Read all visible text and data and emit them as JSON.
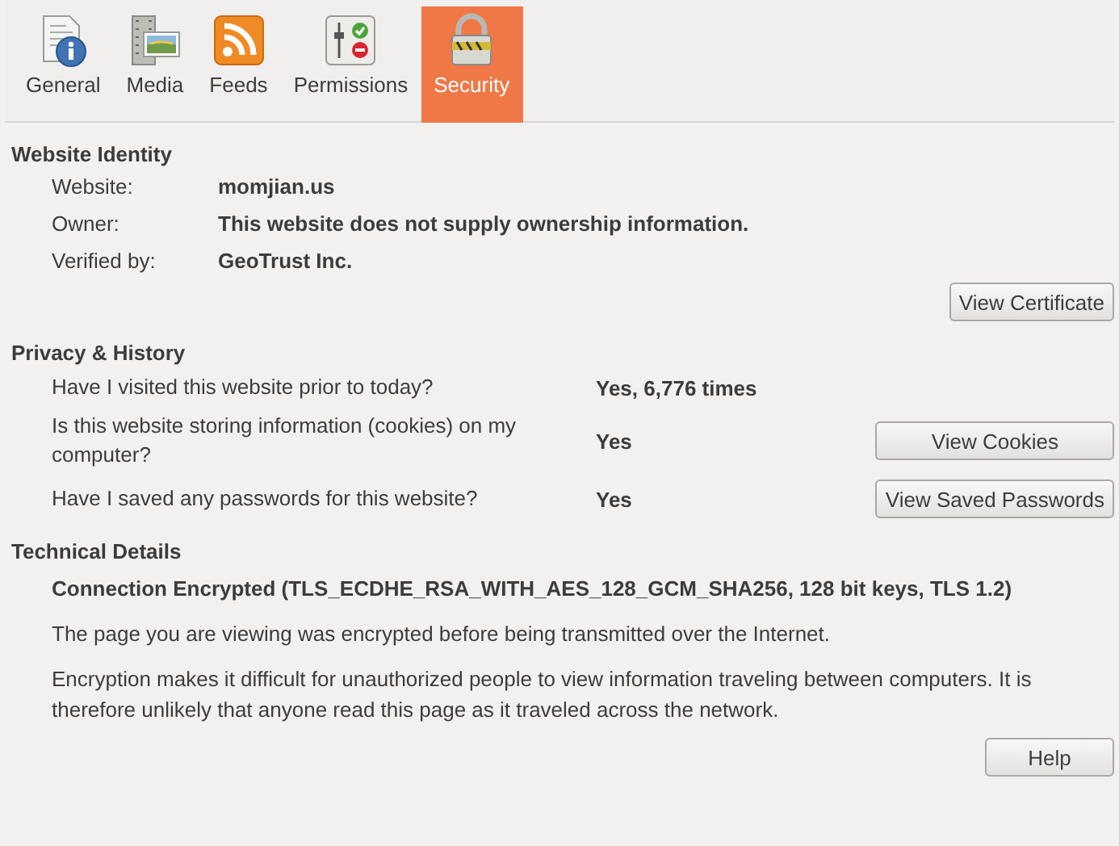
{
  "tabs": [
    {
      "label": "General",
      "kind": "general",
      "selected": false
    },
    {
      "label": "Media",
      "kind": "media",
      "selected": false
    },
    {
      "label": "Feeds",
      "kind": "feeds",
      "selected": false
    },
    {
      "label": "Permissions",
      "kind": "permissions",
      "selected": false
    },
    {
      "label": "Security",
      "kind": "security",
      "selected": true
    }
  ],
  "website_identity": {
    "title": "Website Identity",
    "rows": [
      {
        "label": "Website:",
        "value": "momjian.us"
      },
      {
        "label": "Owner:",
        "value": "This website does not supply ownership information."
      },
      {
        "label": "Verified by:",
        "value": "GeoTrust Inc."
      }
    ],
    "button": "View Certificate"
  },
  "privacy_history": {
    "title": "Privacy & History",
    "rows": [
      {
        "question": "Have I visited this website prior to today?",
        "answer": "Yes, 6,776 times"
      },
      {
        "question": "Is this website storing information (cookies) on my computer?",
        "answer": "Yes",
        "button": "View Cookies"
      },
      {
        "question": "Have I saved any passwords for this website?",
        "answer": "Yes",
        "button": "View Saved Passwords"
      }
    ]
  },
  "technical_details": {
    "title": "Technical Details",
    "heading": "Connection Encrypted (TLS_ECDHE_RSA_WITH_AES_128_GCM_SHA256, 128 bit keys, TLS 1.2)",
    "paragraphs": [
      "The page you are viewing was encrypted before being transmitted over the Internet.",
      "Encryption makes it difficult for unauthorized people to view information traveling between computers. It is therefore unlikely that anyone read this page as it traveled across the network."
    ]
  },
  "help_button": "Help"
}
